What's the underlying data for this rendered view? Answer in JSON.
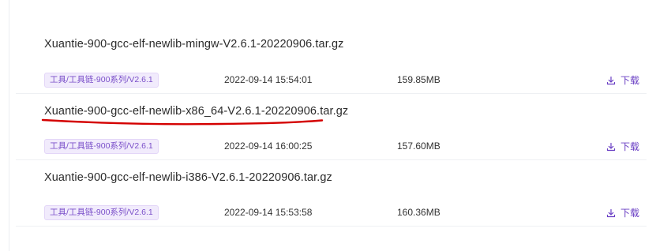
{
  "files": [
    {
      "name": "Xuantie-900-gcc-elf-newlib-mingw-V2.6.1-20220906.tar.gz",
      "tag": "工具/工具链-900系列/V2.6.1",
      "date": "2022-09-14 15:54:01",
      "size": "159.85MB",
      "download_label": "下载"
    },
    {
      "name": "Xuantie-900-gcc-elf-newlib-x86_64-V2.6.1-20220906.tar.gz",
      "tag": "工具/工具链-900系列/V2.6.1",
      "date": "2022-09-14 16:00:25",
      "size": "157.60MB",
      "download_label": "下载"
    },
    {
      "name": "Xuantie-900-gcc-elf-newlib-i386-V2.6.1-20220906.tar.gz",
      "tag": "工具/工具链-900系列/V2.6.1",
      "date": "2022-09-14 15:53:58",
      "size": "160.36MB",
      "download_label": "下载"
    }
  ],
  "colors": {
    "accent": "#6a3fc4",
    "tag_text": "#7a4fc9",
    "tag_bg": "#f1ebfc",
    "annotation": "#d40000"
  },
  "icons": {
    "download": "download-icon"
  }
}
